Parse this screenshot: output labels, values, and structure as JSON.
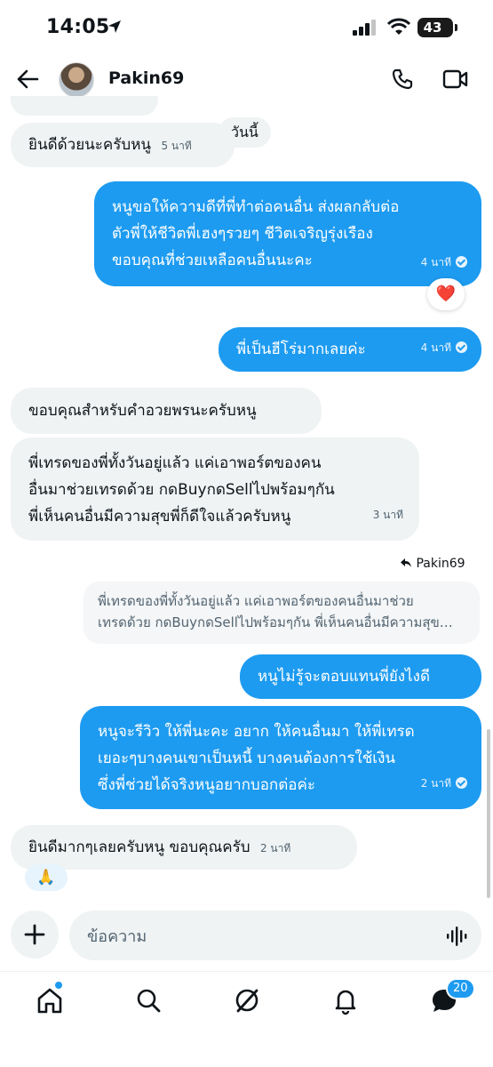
{
  "status_bar": {
    "time": "14:05",
    "battery": "43"
  },
  "header": {
    "contact_name": "Pakin69"
  },
  "messages": {
    "m1": {
      "text": "ยินดีด้วยนะครับหนู",
      "time": "5 นาที"
    },
    "today_label": "วันนี้",
    "m2": {
      "lines": [
        "หนูขอให้ความดีที่พี่ทำต่อคนอื่น ส่งผลกลับต่อ",
        "ตัวพี่ให้ชีวิตพี่เฮงๆรวยๆ ชีวิตเจริญรุ่งเรือง",
        "ขอบคุณที่ช่วยเหลือคนอื่นนะคะ"
      ],
      "time": "4 นาที",
      "reaction": "❤️"
    },
    "m3": {
      "text": "พี่เป็นฮีโร่มากเลยค่ะ",
      "time": "4 นาที"
    },
    "m4": {
      "text": "ขอบคุณสำหรับคำอวยพรนะครับหนู"
    },
    "m5": {
      "lines": [
        "พี่เทรดของพี่ทั้งวันอยู่แล้ว แค่เอาพอร์ตของคน",
        "อื่นมาช่วยเทรดด้วย กดBuyกดSellไปพร้อมๆกัน",
        "พี่เห็นคนอื่นมีความสุขพี่ก็ดีใจแล้วครับหนู"
      ],
      "time": "3 นาที"
    },
    "reply_to": "Pakin69",
    "quote": {
      "lines": [
        "พี่เทรดของพี่ทั้งวันอยู่แล้ว แค่เอาพอร์ตของคนอื่นมาช่วย",
        "เทรดด้วย กดBuyกดSellไปพร้อมๆกัน พี่เห็นคนอื่นมีความสุข…"
      ]
    },
    "m6": {
      "text": "หนูไม่รู้จะตอบแทนพี่ยังไงดี"
    },
    "m7": {
      "lines": [
        "หนูจะรีวิว ให้พี่นะคะ อยาก ให้คนอื่นมา ให้พี่เทรด",
        "เยอะๆบางคนเขาเป็นหนี้ บางคนต้องการใช้เงิน",
        "ซึ่งพี่ช่วยได้จริงหนูอยากบอกต่อค่ะ"
      ],
      "time": "2 นาที"
    },
    "m8": {
      "text": "ยินดีมากๆเลยครับหนู ขอบคุณครับ",
      "time": "2 นาที",
      "reaction": "🙏"
    }
  },
  "composer": {
    "placeholder": "ข้อความ"
  },
  "tabs": {
    "messages_badge": "20"
  },
  "colors": {
    "accent": "#1d9bf0",
    "incoming_bubble": "#eff3f4"
  }
}
